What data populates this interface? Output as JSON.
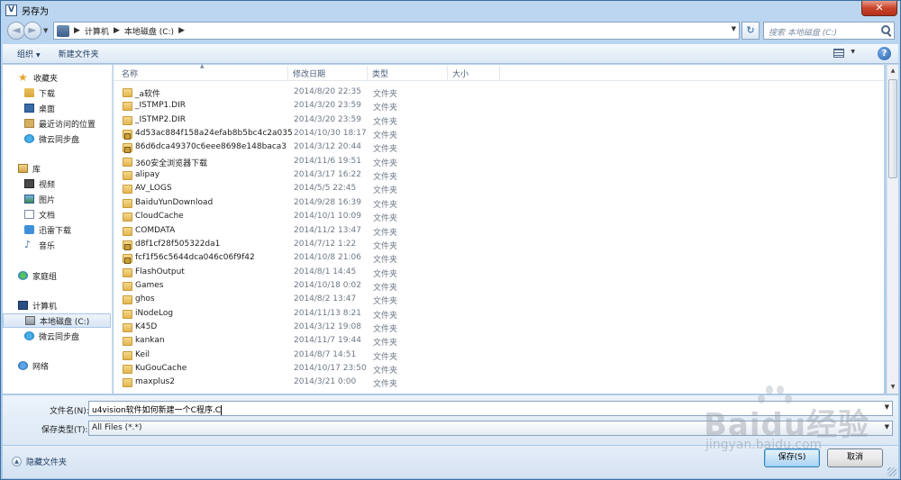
{
  "window": {
    "title": "另存为",
    "app_icon_glyph": "V",
    "close_glyph": "✕"
  },
  "nav": {
    "back_glyph": "◄",
    "forward_glyph": "►",
    "dropdown_glyph": "▼",
    "breadcrumb": [
      "计算机",
      "本地磁盘 (C:)"
    ],
    "separator": "▶",
    "refresh_glyph": "↻",
    "search_placeholder": "搜索 本地磁盘 (C:)"
  },
  "toolbar": {
    "organize": "组织",
    "new_folder": "新建文件夹",
    "help_glyph": "?",
    "arrow_glyph": "▼"
  },
  "sidebar": {
    "items": [
      {
        "label": "收藏夹",
        "icon": "star-icon"
      },
      {
        "label": "下载",
        "icon": "download-folder-icon"
      },
      {
        "label": "桌面",
        "icon": "desktop-icon"
      },
      {
        "label": "最近访问的位置",
        "icon": "recent-places-icon"
      },
      {
        "label": "微云同步盘",
        "icon": "weiyun-icon"
      },
      {
        "label": "库",
        "icon": "library-icon"
      },
      {
        "label": "视频",
        "icon": "video-icon"
      },
      {
        "label": "图片",
        "icon": "picture-icon"
      },
      {
        "label": "文档",
        "icon": "document-icon"
      },
      {
        "label": "迅雷下载",
        "icon": "thunder-icon"
      },
      {
        "label": "音乐",
        "icon": "music-icon"
      },
      {
        "label": "家庭组",
        "icon": "homegroup-icon"
      },
      {
        "label": "计算机",
        "icon": "computer-icon"
      },
      {
        "label": "本地磁盘 (C:)",
        "icon": "disk-icon"
      },
      {
        "label": "微云同步盘",
        "icon": "weiyun-icon"
      },
      {
        "label": "网络",
        "icon": "network-icon"
      }
    ]
  },
  "columns": {
    "name": "名称",
    "date": "修改日期",
    "type": "类型",
    "size": "大小",
    "sort_glyph": "▲"
  },
  "files": [
    {
      "name": "_a软件",
      "date": "2014/8/20 22:35",
      "type": "文件夹",
      "locked": false
    },
    {
      "name": "_ISTMP1.DIR",
      "date": "2014/3/20 23:59",
      "type": "文件夹",
      "locked": false
    },
    {
      "name": "_ISTMP2.DIR",
      "date": "2014/3/20 23:59",
      "type": "文件夹",
      "locked": false
    },
    {
      "name": "4d53ac884f158a24efab8b5bc4c2a035",
      "date": "2014/10/30 18:17",
      "type": "文件夹",
      "locked": true
    },
    {
      "name": "86d6dca49370c6eee8698e148baca3",
      "date": "2014/3/12 20:44",
      "type": "文件夹",
      "locked": true
    },
    {
      "name": "360安全浏览器下载",
      "date": "2014/11/6 19:51",
      "type": "文件夹",
      "locked": false
    },
    {
      "name": "alipay",
      "date": "2014/3/17 16:22",
      "type": "文件夹",
      "locked": false
    },
    {
      "name": "AV_LOGS",
      "date": "2014/5/5 22:45",
      "type": "文件夹",
      "locked": false
    },
    {
      "name": "BaiduYunDownload",
      "date": "2014/9/28 16:39",
      "type": "文件夹",
      "locked": false
    },
    {
      "name": "CloudCache",
      "date": "2014/10/1 10:09",
      "type": "文件夹",
      "locked": false
    },
    {
      "name": "COMDATA",
      "date": "2014/11/2 13:47",
      "type": "文件夹",
      "locked": false
    },
    {
      "name": "d8f1cf28f505322da1",
      "date": "2014/7/12 1:22",
      "type": "文件夹",
      "locked": true
    },
    {
      "name": "fcf1f56c5644dca046c06f9f42",
      "date": "2014/10/8 21:06",
      "type": "文件夹",
      "locked": true
    },
    {
      "name": "FlashOutput",
      "date": "2014/8/1 14:45",
      "type": "文件夹",
      "locked": false
    },
    {
      "name": "Games",
      "date": "2014/10/18 0:02",
      "type": "文件夹",
      "locked": false
    },
    {
      "name": "ghos",
      "date": "2014/8/2 13:47",
      "type": "文件夹",
      "locked": false
    },
    {
      "name": "iNodeLog",
      "date": "2014/11/13 8:21",
      "type": "文件夹",
      "locked": false
    },
    {
      "name": "K45D",
      "date": "2014/3/12 19:08",
      "type": "文件夹",
      "locked": false
    },
    {
      "name": "kankan",
      "date": "2014/11/7 19:44",
      "type": "文件夹",
      "locked": false
    },
    {
      "name": "Keil",
      "date": "2014/8/7 14:51",
      "type": "文件夹",
      "locked": false
    },
    {
      "name": "KuGouCache",
      "date": "2014/10/17 23:50",
      "type": "文件夹",
      "locked": false
    },
    {
      "name": "maxplus2",
      "date": "2014/3/21 0:00",
      "type": "文件夹",
      "locked": false
    }
  ],
  "form": {
    "filename_label": "文件名(N):",
    "filename_value": "u4vision软件如何新建一个C程序.C",
    "filetype_label": "保存类型(T):",
    "filetype_value": "All Files (*.*)"
  },
  "footer": {
    "hide_folders": "隐藏文件夹",
    "hide_glyph": "▲",
    "save": "保存(S)",
    "cancel": "取消"
  },
  "watermark": {
    "brand": "Baidu经验",
    "url": "jingyan.baidu.com"
  }
}
